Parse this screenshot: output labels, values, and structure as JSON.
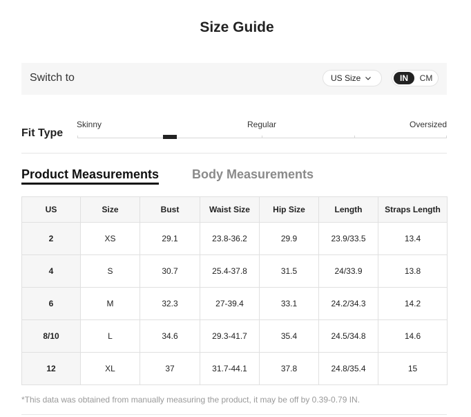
{
  "title": "Size Guide",
  "switch": {
    "label": "Switch to",
    "size_select": "US Size",
    "units": [
      "IN",
      "CM"
    ],
    "selected_unit": "IN"
  },
  "fit": {
    "label": "Fit Type",
    "scale": [
      "Skinny",
      "Regular",
      "Oversized"
    ],
    "position": 0.25
  },
  "tabs": [
    {
      "label": "Product Measurements",
      "active": true
    },
    {
      "label": "Body Measurements",
      "active": false
    }
  ],
  "table": {
    "headers": [
      "US",
      "Size",
      "Bust",
      "Waist Size",
      "Hip Size",
      "Length",
      "Straps Length"
    ],
    "rows": [
      [
        "2",
        "XS",
        "29.1",
        "23.8-36.2",
        "29.9",
        "23.9/33.5",
        "13.4"
      ],
      [
        "4",
        "S",
        "30.7",
        "25.4-37.8",
        "31.5",
        "24/33.9",
        "13.8"
      ],
      [
        "6",
        "M",
        "32.3",
        "27-39.4",
        "33.1",
        "24.2/34.3",
        "14.2"
      ],
      [
        "8/10",
        "L",
        "34.6",
        "29.3-41.7",
        "35.4",
        "24.5/34.8",
        "14.6"
      ],
      [
        "12",
        "XL",
        "37",
        "31.7-44.1",
        "37.8",
        "24.8/35.4",
        "15"
      ]
    ]
  },
  "note": "*This data was obtained from manually measuring the product, it may be off by 0.39-0.79 IN."
}
